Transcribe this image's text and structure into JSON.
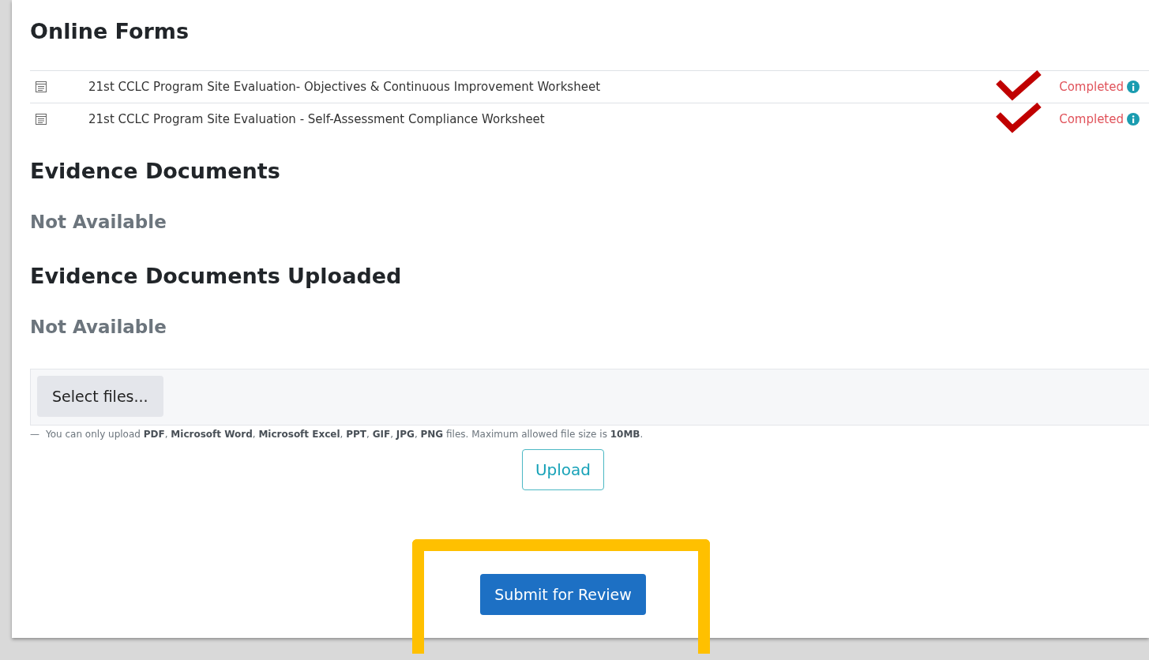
{
  "sections": [
    {
      "kind": "forms",
      "title": "Online Forms",
      "items": [
        {
          "title": "21st CCLC Program Site Evaluation- Objectives & Continuous Improvement Worksheet",
          "status": "Completed",
          "check_mark": true
        },
        {
          "title": "21st CCLC Program Site Evaluation - Self-Assessment Compliance Worksheet",
          "status": "Completed",
          "check_mark": true
        }
      ]
    },
    {
      "kind": "empty",
      "title": "Evidence Documents",
      "message": "Not Available"
    },
    {
      "kind": "empty",
      "title": "Evidence Documents Uploaded",
      "message": "Not Available"
    }
  ],
  "upload": {
    "select_button": "Select files...",
    "hint_dash": "—",
    "hint": "You can only upload **PDF**, **Microsoft Word**, **Microsoft Excel**, **PPT**, **GIF**, **JPG**, **PNG** files. Maximum allowed file size is **10MB**.",
    "upload_button": "Upload"
  },
  "submit": {
    "label": "Submit for Review",
    "highlighted": true
  }
}
